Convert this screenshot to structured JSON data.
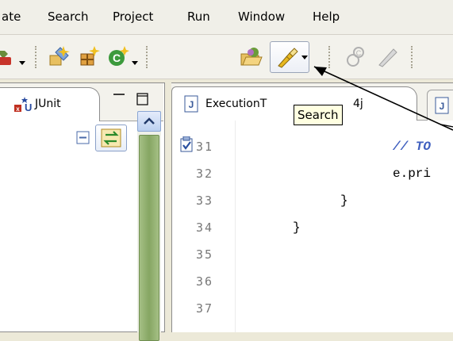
{
  "menubar": {
    "items": [
      {
        "label": "ate"
      },
      {
        "label": "Search"
      },
      {
        "label": "Project"
      },
      {
        "label": "Run"
      },
      {
        "label": "Window"
      },
      {
        "label": "Help"
      }
    ]
  },
  "left_view": {
    "tab_label": "JUnit"
  },
  "editor": {
    "tab_label": "ExecutionT",
    "tab_label_tail": "4j",
    "lines": [
      {
        "number": "31",
        "code": "// TO",
        "kind": "comment"
      },
      {
        "number": "32",
        "code": "e.pri",
        "kind": "code"
      },
      {
        "number": "33",
        "code": "}",
        "kind": "code"
      },
      {
        "number": "34",
        "code": "}",
        "kind": "code"
      },
      {
        "number": "35",
        "code": "",
        "kind": "code"
      },
      {
        "number": "36",
        "code": "",
        "kind": "code"
      },
      {
        "number": "37",
        "code": "",
        "kind": "code"
      }
    ]
  },
  "tooltip": {
    "text": "Search"
  },
  "colors": {
    "comment": "#3f5fbf",
    "tooltip_bg": "#ffffe1",
    "scroll_thumb": "#86a663"
  }
}
